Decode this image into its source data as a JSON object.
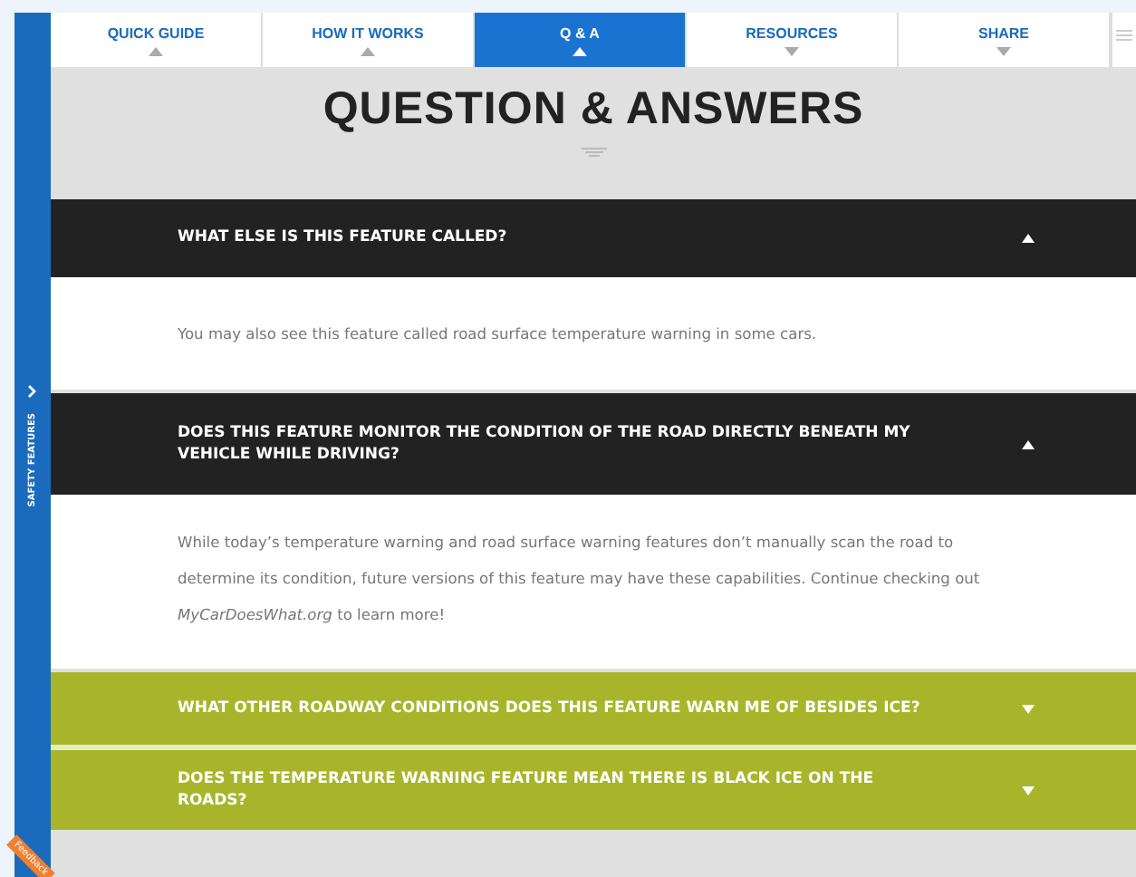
{
  "sidebar": {
    "label": "SAFETY FEATURES",
    "feedback": "Feedback"
  },
  "tabs": [
    {
      "label": "QUICK GUIDE",
      "selected": false,
      "kind": "up"
    },
    {
      "label": "HOW IT WORKS",
      "selected": false,
      "kind": "up"
    },
    {
      "label": "Q & A",
      "selected": true,
      "kind": "up"
    },
    {
      "label": "RESOURCES",
      "selected": false,
      "kind": "down"
    },
    {
      "label": "SHARE",
      "selected": false,
      "kind": "down"
    }
  ],
  "title": "QUESTION & ANSWERS",
  "faq": [
    {
      "question": "WHAT ELSE IS THIS FEATURE CALLED?",
      "expanded": true,
      "answer": "You may also see this feature called road surface temperature warning in some cars."
    },
    {
      "question": "DOES THIS FEATURE MONITOR THE CONDITION OF THE ROAD DIRECTLY BENEATH MY VEHICLE WHILE DRIVING?",
      "expanded": true,
      "answer": "While today’s temperature warning and road surface warning features don’t manually scan the road to determine its condition, future versions of this feature may have these capabilities. Continue checking out *MyCarDoesWhat.org* to learn more!"
    },
    {
      "question": "WHAT OTHER ROADWAY CONDITIONS DOES THIS FEATURE WARN ME OF BESIDES ICE?",
      "expanded": false
    },
    {
      "question": "DOES THE TEMPERATURE WARNING FEATURE MEAN THERE IS BLACK ICE ON THE ROADS?",
      "expanded": false
    }
  ]
}
